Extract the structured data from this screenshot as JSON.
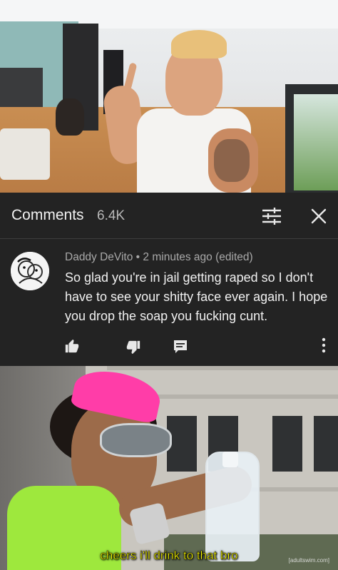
{
  "comments_header": {
    "title": "Comments",
    "count": "6.4K"
  },
  "comment": {
    "author": "Daddy DeVito",
    "separator": "•",
    "time": "2 minutes ago (edited)",
    "text": "So glad you're in jail getting raped so I don't have to see your shitty face ever again. I hope you drop the soap you fucking cunt."
  },
  "icons": {
    "filter": "filter-sliders-icon",
    "close": "close-icon",
    "like": "thumbs-up-icon",
    "dislike": "thumbs-down-icon",
    "reply": "reply-icon",
    "more": "more-vert-icon"
  },
  "meme": {
    "subtitle": "cheers i'll drink to that bro",
    "watermark": "[adultswim.com]"
  },
  "colors": {
    "panel_bg": "#232323",
    "text_primary": "#f1f1f1",
    "text_secondary": "#a9a9a9",
    "subtitle": "#ffff00"
  }
}
